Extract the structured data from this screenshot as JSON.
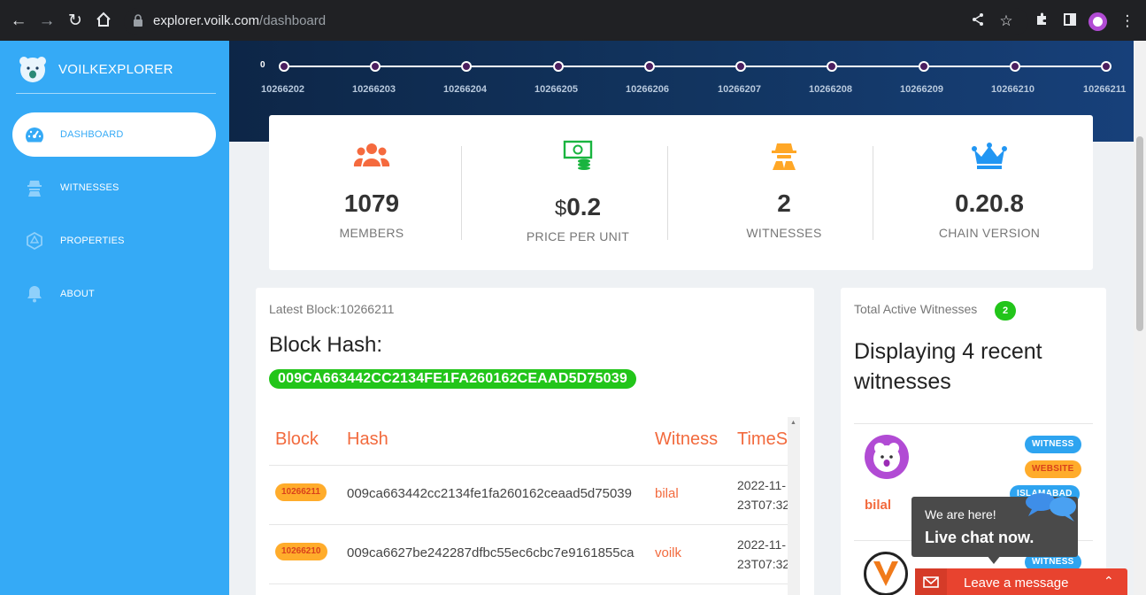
{
  "browser": {
    "url_host": "explorer.voilk.com",
    "url_path": "/dashboard"
  },
  "sidebar": {
    "brand": "VOILKEXPLORER",
    "items": [
      {
        "label": "DASHBOARD",
        "icon": "gauge-icon",
        "active": true
      },
      {
        "label": "WITNESSES",
        "icon": "spy-icon",
        "active": false
      },
      {
        "label": "PROPERTIES",
        "icon": "dice-icon",
        "active": false
      },
      {
        "label": "ABOUT",
        "icon": "bell-icon",
        "active": false
      }
    ]
  },
  "timeline": {
    "zero_label": "0",
    "blocks": [
      "10266202",
      "10266203",
      "10266204",
      "10266205",
      "10266206",
      "10266207",
      "10266208",
      "10266209",
      "10266210",
      "10266211"
    ]
  },
  "stats": [
    {
      "value": "1079",
      "label": "MEMBERS",
      "icon": "users-icon"
    },
    {
      "currency": "$",
      "value": "0.2",
      "label": "PRICE PER UNIT",
      "icon": "money-icon"
    },
    {
      "value": "2",
      "label": "WITNESSES",
      "icon": "spy-icon"
    },
    {
      "value": "0.20.8",
      "label": "CHAIN VERSION",
      "icon": "crown-icon"
    }
  ],
  "latest": {
    "label": "Latest Block:10266211",
    "hash_title": "Block Hash:",
    "hash": "009CA663442CC2134FE1FA260162CEAAD5D75039"
  },
  "table": {
    "headers": [
      "Block",
      "Hash",
      "Witness",
      "TimeS"
    ],
    "rows": [
      {
        "block": "10266211",
        "hash": "009ca663442cc2134fe1fa260162ceaad5d75039",
        "witness": "bilal",
        "time_l1": "2022-11-",
        "time_l2": "23T07:32"
      },
      {
        "block": "10266210",
        "hash": "009ca6627be242287dfbc55ec6cbc7e9161855ca",
        "witness": "voilk",
        "time_l1": "2022-11-",
        "time_l2": "23T07:32"
      }
    ]
  },
  "witnesses_panel": {
    "total_label": "Total Active Witnesses",
    "total_count": "2",
    "heading": "Displaying 4 recent witnesses",
    "items": [
      {
        "name": "bilal",
        "tags": [
          "WITNESS",
          "WEBSITE",
          "ISLAMABAD"
        ]
      },
      {
        "name": "",
        "tags": [
          "WITNESS"
        ]
      }
    ]
  },
  "chat": {
    "line1": "We are here!",
    "line2": "Live chat now.",
    "leave": "Leave a message"
  },
  "colors": {
    "sidebar": "#35aaf6",
    "accent_orange": "#f26a3d",
    "hash_green": "#22c51a",
    "hero_navy": "#0d2647"
  }
}
